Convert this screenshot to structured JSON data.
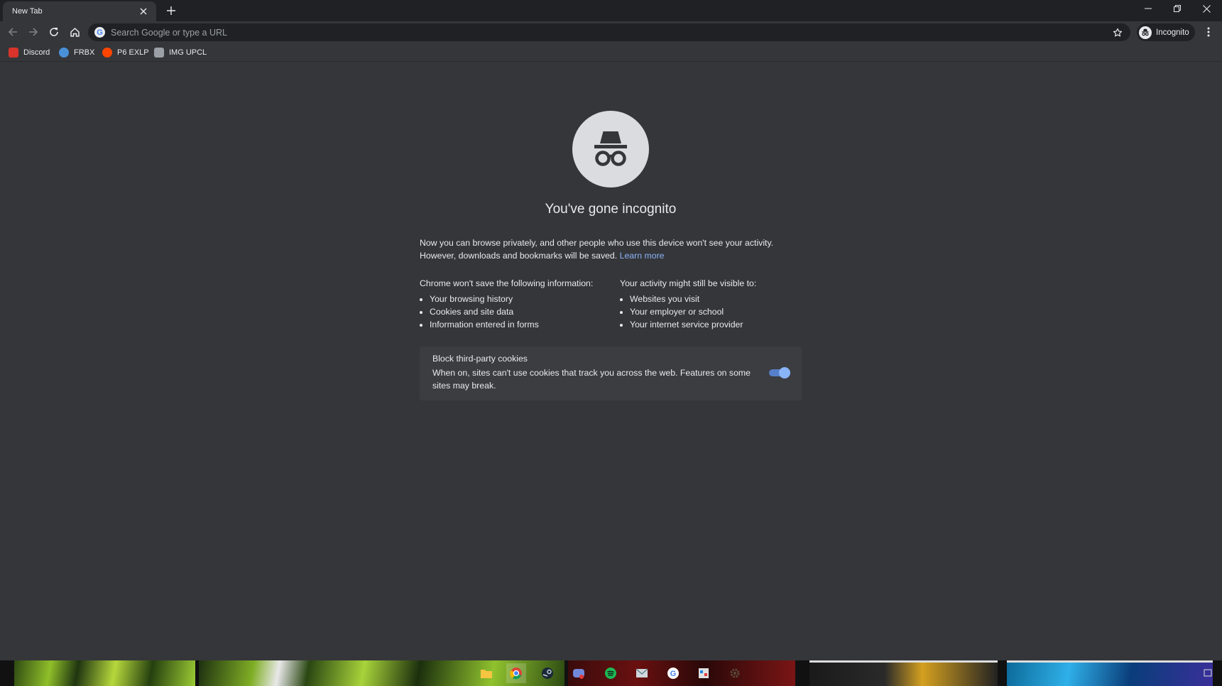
{
  "tab": {
    "title": "New Tab"
  },
  "omnibox": {
    "placeholder": "Search Google or type a URL"
  },
  "profile": {
    "label": "Incognito"
  },
  "bookmarks": [
    {
      "label": "Discord",
      "icon": "discord-icon",
      "color": "#d8342c"
    },
    {
      "label": "FRBX",
      "icon": "frbx-icon",
      "color": "#4a90d9"
    },
    {
      "label": "P6 EXLP",
      "icon": "reddit-icon",
      "color": "#ff4500"
    },
    {
      "label": "IMG UPCL",
      "icon": "img-icon",
      "color": "#9aa0a6"
    }
  ],
  "main": {
    "title": "You've gone incognito",
    "intro_text": "Now you can browse privately, and other people who use this device won't see your activity. However, downloads and bookmarks will be saved.",
    "learn_more": "Learn more",
    "left_heading": "Chrome won't save the following information:",
    "left_items": [
      "Your browsing history",
      "Cookies and site data",
      "Information entered in forms"
    ],
    "right_heading": "Your activity might still be visible to:",
    "right_items": [
      "Websites you visit",
      "Your employer or school",
      "Your internet service provider"
    ]
  },
  "cookies": {
    "title": "Block third-party cookies",
    "description": "When on, sites can't use cookies that track you across the web. Features on some sites may break.",
    "enabled": true
  },
  "colors": {
    "frame": "#202124",
    "page_background": "#35363a",
    "link": "#8ab4f8",
    "toggle_on": "#8ab4f8"
  },
  "taskbar": {
    "apps": [
      "file-explorer-icon",
      "chrome-icon",
      "steam-icon",
      "discord-icon",
      "spotify-icon",
      "mail-icon",
      "google-icon",
      "control-panel-icon",
      "settings-icon"
    ]
  }
}
